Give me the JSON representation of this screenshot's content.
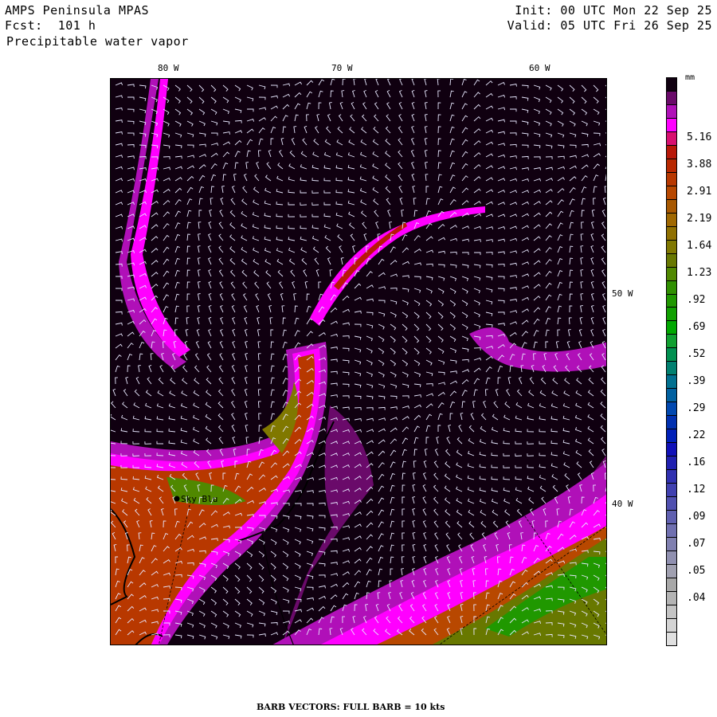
{
  "header": {
    "model": "AMPS Peninsula MPAS",
    "forecast": "Fcst:  101 h",
    "field": "Precipitable water vapor",
    "init": "Init: 00 UTC Mon 22 Sep 25",
    "valid": "Valid: 05 UTC Fri 26 Sep 25"
  },
  "axes": {
    "top_labels": [
      "80 W",
      "70 W",
      "60 W"
    ],
    "right_labels": [
      "50 W",
      "40 W"
    ]
  },
  "station": {
    "name": "Sky Blu"
  },
  "colorbar": {
    "unit": "mm",
    "labels": [
      "5.16",
      "3.88",
      "2.91",
      "2.19",
      "1.64",
      "1.23",
      ".92",
      ".69",
      ".52",
      ".39",
      ".29",
      ".22",
      ".16",
      ".12",
      ".09",
      ".07",
      ".05",
      ".04"
    ],
    "colors_top_to_bottom": [
      "#100010",
      "#6a0a6a",
      "#b010b8",
      "#ff00ff",
      "#d81070",
      "#b81808",
      "#b82800",
      "#b83800",
      "#b84800",
      "#a85800",
      "#a06800",
      "#907000",
      "#807800",
      "#687800",
      "#508800",
      "#309000",
      "#209800",
      "#10a000",
      "#00a800",
      "#10a030",
      "#009050",
      "#008070",
      "#007090",
      "#0060a0",
      "#0048b0",
      "#0030b0",
      "#0020b8",
      "#1010b8",
      "#2020b0",
      "#3030b0",
      "#4040b0",
      "#5050b0",
      "#6060b0",
      "#7070b0",
      "#8080b0",
      "#9090b0",
      "#a0a0b0",
      "#a8a8a8",
      "#b4b4b4",
      "#c4c4c4",
      "#d4d4d4",
      "#e0e0e0"
    ]
  },
  "footer": {
    "barb_note": "BARB VECTORS:  FULL BARB = 10 kts"
  }
}
